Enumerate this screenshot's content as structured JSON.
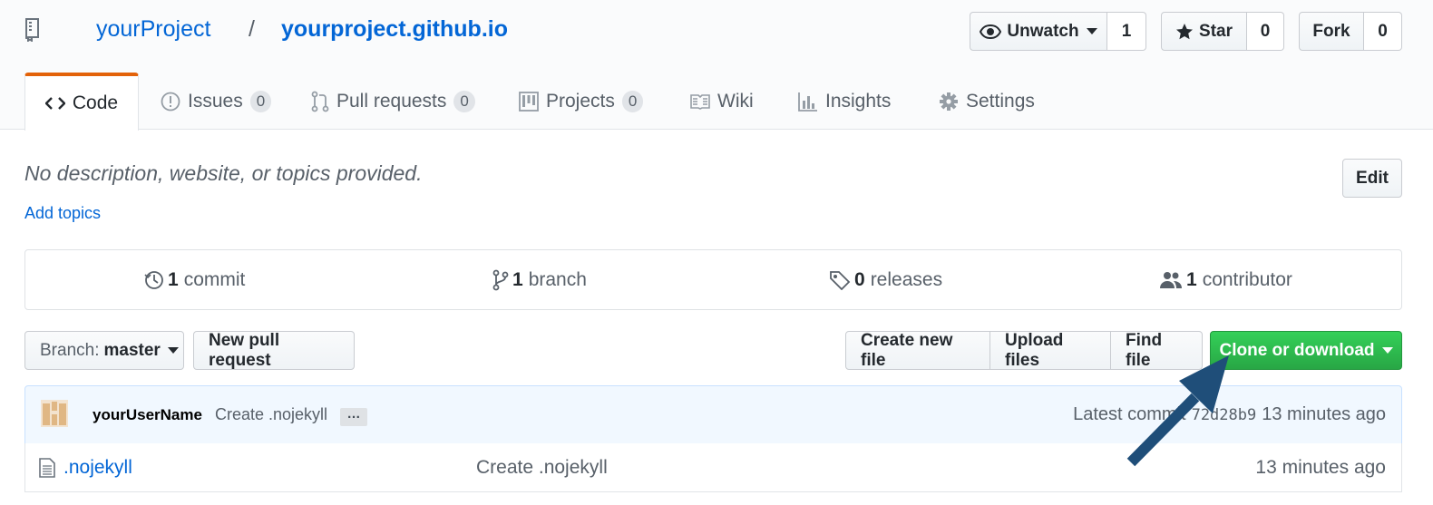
{
  "repo": {
    "owner": "yourProject",
    "separator": "/",
    "name": "yourproject.github.io"
  },
  "actions": {
    "watch_label": "Unwatch",
    "watch_count": "1",
    "star_label": "Star",
    "star_count": "0",
    "fork_label": "Fork",
    "fork_count": "0"
  },
  "tabs": [
    {
      "label": "Code"
    },
    {
      "label": "Issues",
      "count": "0"
    },
    {
      "label": "Pull requests",
      "count": "0"
    },
    {
      "label": "Projects",
      "count": "0"
    },
    {
      "label": "Wiki"
    },
    {
      "label": "Insights"
    },
    {
      "label": "Settings"
    }
  ],
  "description": {
    "text": "No description, website, or topics provided.",
    "add_topics": "Add topics",
    "edit_label": "Edit"
  },
  "summary": {
    "commits_count": "1",
    "commits_label": "commit",
    "branches_count": "1",
    "branches_label": "branch",
    "releases_count": "0",
    "releases_label": "releases",
    "contributors_count": "1",
    "contributors_label": "contributor"
  },
  "filenav": {
    "branch_prefix": "Branch:",
    "branch_name": "master",
    "new_pr": "New pull request",
    "create_file": "Create new file",
    "upload_files": "Upload files",
    "find_file": "Find file",
    "clone": "Clone or download"
  },
  "commit": {
    "author": "yourUserName",
    "message": "Create .nojekyll",
    "ellipsis": "…",
    "latest_label": "Latest commit",
    "sha": "72d28b9",
    "age": "13 minutes ago"
  },
  "files": [
    {
      "name": ".nojekyll",
      "message": "Create .nojekyll",
      "age": "13 minutes ago"
    }
  ],
  "colors": {
    "link": "#0366d6",
    "clone_green": "#28a745",
    "tab_accent": "#e36209",
    "arrow": "#1f4e79"
  }
}
